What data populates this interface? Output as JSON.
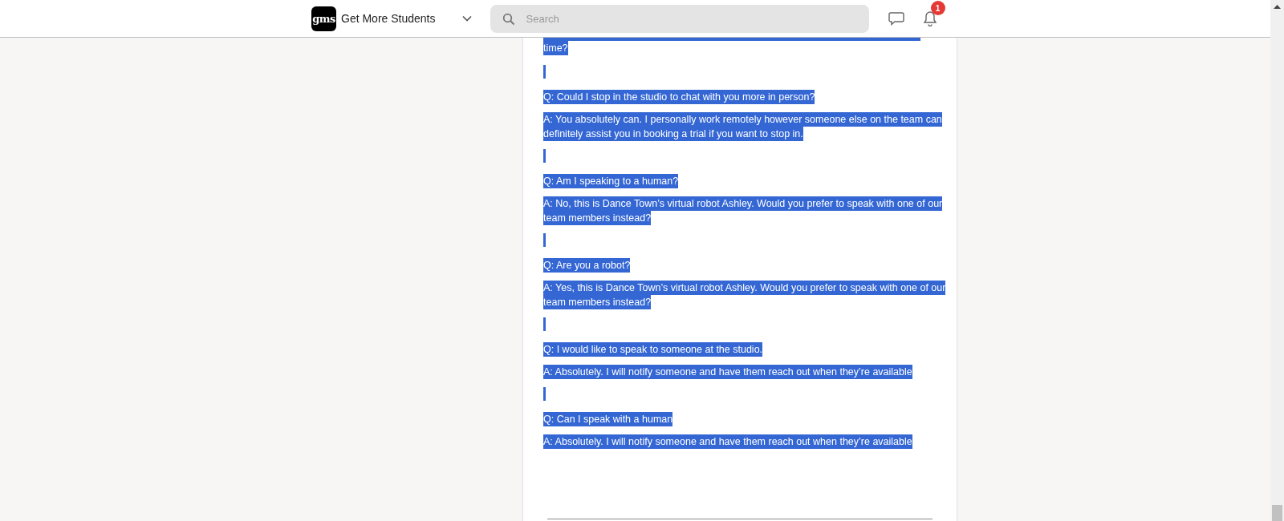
{
  "header": {
    "logo": "gms",
    "workspace": "Get More Students",
    "search": {
      "placeholder": "Search"
    },
    "notifications": {
      "badge": "1"
    }
  },
  "document": {
    "blocks": [
      {
        "kind": "clipped"
      },
      {
        "kind": "text",
        "lines": [
          "time?"
        ]
      },
      {
        "kind": "cursor"
      },
      {
        "kind": "text",
        "lines": [
          "Q: Could I stop in the studio to chat with you more in person?"
        ]
      },
      {
        "kind": "text",
        "lines": [
          "A: You absolutely can. I personally work remotely however someone else on the team can",
          "definitely assist you in booking a trial if you want to stop in."
        ]
      },
      {
        "kind": "cursor"
      },
      {
        "kind": "text",
        "lines": [
          "Q: Am I speaking to a human?"
        ]
      },
      {
        "kind": "text",
        "lines": [
          "A: No, this is Dance Town’s virtual robot Ashley. Would you prefer to speak with one of our",
          "team members instead?"
        ]
      },
      {
        "kind": "cursor"
      },
      {
        "kind": "text",
        "lines": [
          "Q: Are you a robot?"
        ]
      },
      {
        "kind": "text",
        "lines": [
          "A: Yes, this is Dance Town’s virtual robot Ashley. Would you prefer to speak with one of our",
          "team members instead?"
        ]
      },
      {
        "kind": "cursor"
      },
      {
        "kind": "text",
        "lines": [
          "Q: I would like to speak to someone at the studio."
        ]
      },
      {
        "kind": "text",
        "lines": [
          "A: Absolutely. I will notify someone and have them reach out when they’re available"
        ]
      },
      {
        "kind": "cursor"
      },
      {
        "kind": "text",
        "lines": [
          "Q: Can I speak with a human"
        ]
      },
      {
        "kind": "text",
        "lines": [
          "A: Absolutely. I will notify someone and have them reach out when they’re available"
        ]
      }
    ]
  }
}
